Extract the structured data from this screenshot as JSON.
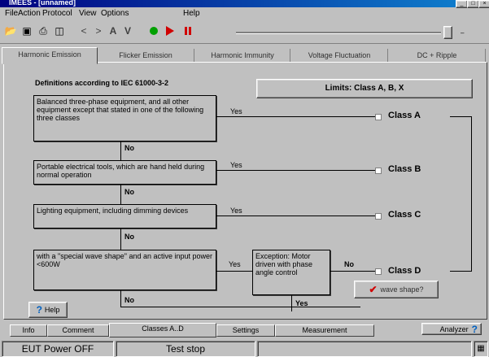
{
  "window": {
    "title": "IMEES - [unnamed]"
  },
  "menu": [
    "File",
    "Action",
    "Protocol",
    "View",
    "Options",
    "Help"
  ],
  "top_tabs": [
    "Harmonic Emission",
    "Flicker Emission",
    "Harmonic Immunity",
    "Voltage Fluctuation",
    "DC + Ripple"
  ],
  "panel": {
    "heading": "Definitions according to IEC 61000-3-2",
    "limits_button": "Limits: Class A, B, X",
    "boxes": [
      "Balanced three-phase equipment, and all other equipment except that stated in one of the following three classes",
      "Portable electrical tools, which are hand held during normal operation",
      "Lighting equipment, including dimming devices",
      "with a \"special wave shape\" and an active input power <600W"
    ],
    "exception_box": "Exception: Motor driven with phase angle control",
    "yes": "Yes",
    "no": "No",
    "classes": [
      "Class A",
      "Class B",
      "Class C",
      "Class D"
    ],
    "wave_button": "wave shape?",
    "help_button": "Help"
  },
  "bottom_tabs": [
    "Info",
    "Comment",
    "Classes A..D",
    "Settings",
    "Measurement"
  ],
  "analyzer_button": "Analyzer",
  "status": {
    "power": "EUT Power OFF",
    "test": "Test stop"
  }
}
